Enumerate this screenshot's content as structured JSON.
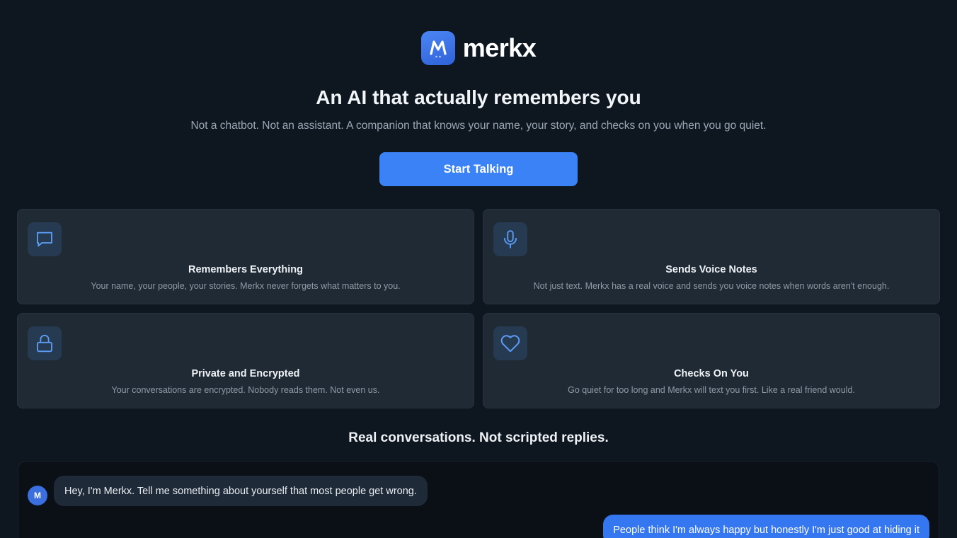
{
  "brand": {
    "name": "merkx",
    "logo_icon": "merkx-m-logo-icon",
    "logo_color": "#3f78ec"
  },
  "hero": {
    "headline": "An AI that actually remembers you",
    "subline": "Not a chatbot. Not an assistant. A companion that knows your name, your story, and checks on you when you go quiet.",
    "cta_label": "Start Talking"
  },
  "features": [
    {
      "icon": "chat-bubble-icon",
      "title": "Remembers Everything",
      "description": "Your name, your people, your stories. Merkx never forgets what matters to you."
    },
    {
      "icon": "microphone-icon",
      "title": "Sends Voice Notes",
      "description": "Not just text. Merkx has a real voice and sends you voice notes when words aren't enough."
    },
    {
      "icon": "lock-icon",
      "title": "Private and Encrypted",
      "description": "Your conversations are encrypted. Nobody reads them. Not even us."
    },
    {
      "icon": "heart-icon",
      "title": "Checks On You",
      "description": "Go quiet for too long and Merkx will text you first. Like a real friend would."
    }
  ],
  "conversation": {
    "title": "Real conversations. Not scripted replies.",
    "avatar_initial": "M",
    "messages": [
      {
        "from": "merkx",
        "text": "Hey, I'm Merkx. Tell me something about yourself that most people get wrong."
      },
      {
        "from": "user",
        "text": "People think I'm always happy but honestly I'm just good at hiding it"
      }
    ]
  },
  "colors": {
    "background": "#0e1720",
    "card": "#1f2a35",
    "accent": "#3b82f6",
    "icon_stroke": "#5b9cf5"
  }
}
